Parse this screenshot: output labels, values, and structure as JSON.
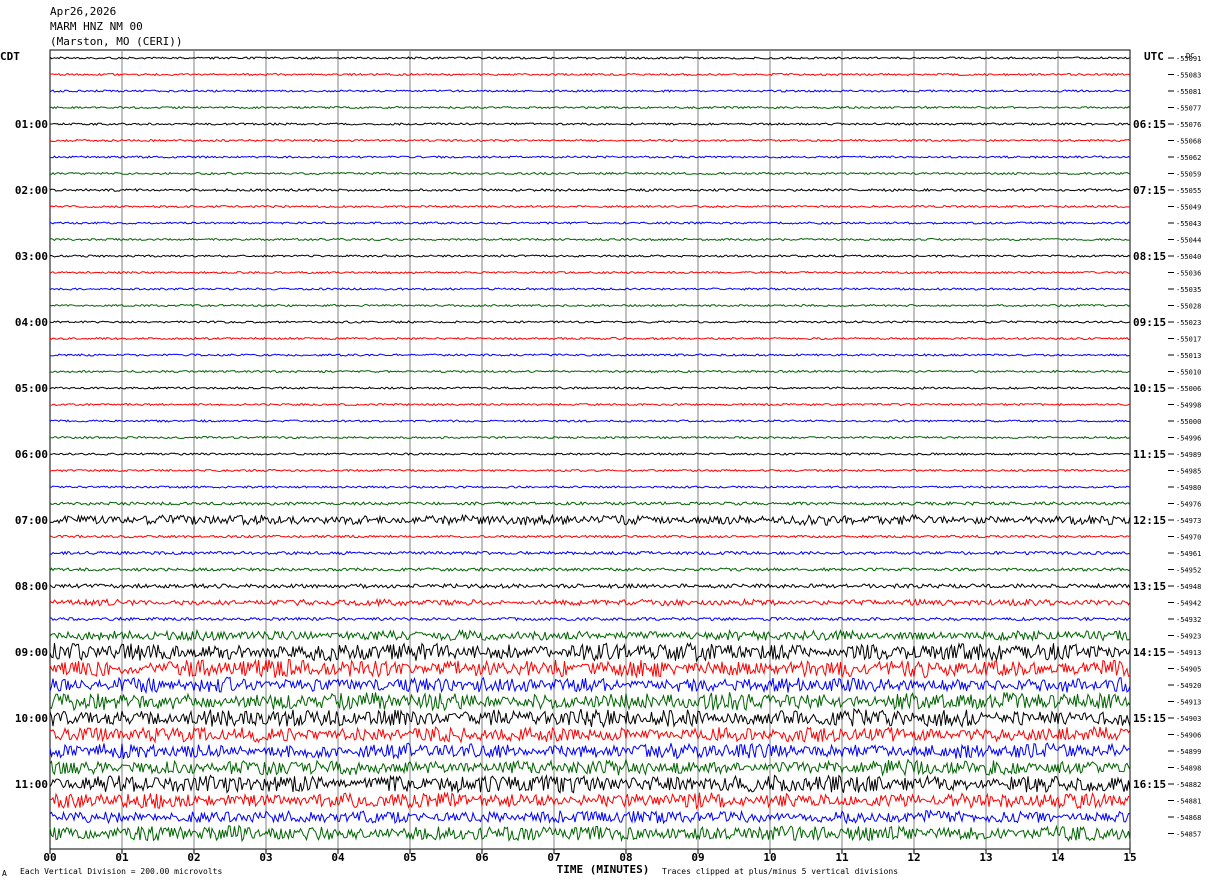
{
  "header": {
    "date": "Apr26,2026",
    "station": "MARM HNZ NM 00",
    "location": "(Marston, MO (CERI))"
  },
  "left_tz": "CDT",
  "right_tz": "UTC",
  "dc_label": "DC",
  "footer": {
    "division_note": "Each Vertical Division =  200.00 microvolts",
    "clip_note": "Traces clipped at plus/minus 5 vertical divisions",
    "corner_mark": "A"
  },
  "colors": {
    "trace_cycle": [
      "#000000",
      "#ff0000",
      "#0000ff",
      "#006400"
    ]
  },
  "chart_data": {
    "type": "line",
    "title": "",
    "xlabel": "TIME (MINUTES)",
    "ylabel": "",
    "x_ticks": [
      "00",
      "01",
      "02",
      "03",
      "04",
      "05",
      "06",
      "07",
      "08",
      "09",
      "10",
      "11",
      "12",
      "13",
      "14",
      "15"
    ],
    "xlim": [
      0,
      15
    ],
    "grid": true,
    "left_time_labels": [
      "01:00",
      "02:00",
      "03:00",
      "04:00",
      "05:00",
      "06:00",
      "07:00",
      "08:00",
      "09:00",
      "10:00",
      "11:00"
    ],
    "right_time_labels": [
      "06:15",
      "07:15",
      "08:15",
      "09:15",
      "10:15",
      "11:15",
      "12:15",
      "13:15",
      "14:15",
      "15:15",
      "16:15"
    ],
    "hour_label_trace_index": [
      4,
      8,
      12,
      16,
      20,
      24,
      28,
      32,
      36,
      40,
      44
    ],
    "dc_offsets": [
      "-55091",
      "-55083",
      "-55081",
      "-55077",
      "-55076",
      "-55068",
      "-55062",
      "-55059",
      "-55055",
      "-55049",
      "-55043",
      "-55044",
      "-55040",
      "-55036",
      "-55035",
      "-55028",
      "-55023",
      "-55017",
      "-55013",
      "-55010",
      "-55006",
      "-54998",
      "-55000",
      "-54996",
      "-54989",
      "-54985",
      "-54980",
      "-54976",
      "-54973",
      "-54970",
      "-54961",
      "-54952",
      "-54948",
      "-54942",
      "-54932",
      "-54923",
      "-54913",
      "-54905",
      "-54920",
      "-54913",
      "-54903",
      "-54906",
      "-54899",
      "-54898",
      "-54882",
      "-54881",
      "-54868",
      "-54857"
    ],
    "trace_activity": [
      1,
      1,
      1,
      1,
      1,
      1,
      1,
      1,
      1.2,
      1,
      1,
      1,
      1,
      1,
      1,
      1,
      1,
      1,
      1,
      1,
      1,
      1,
      1,
      1,
      1,
      1,
      1,
      1.5,
      4,
      1.2,
      1.5,
      1.5,
      2,
      2.5,
      1.5,
      4,
      7,
      7,
      6,
      7,
      7,
      6,
      6,
      6,
      7,
      6,
      5,
      6
    ]
  }
}
